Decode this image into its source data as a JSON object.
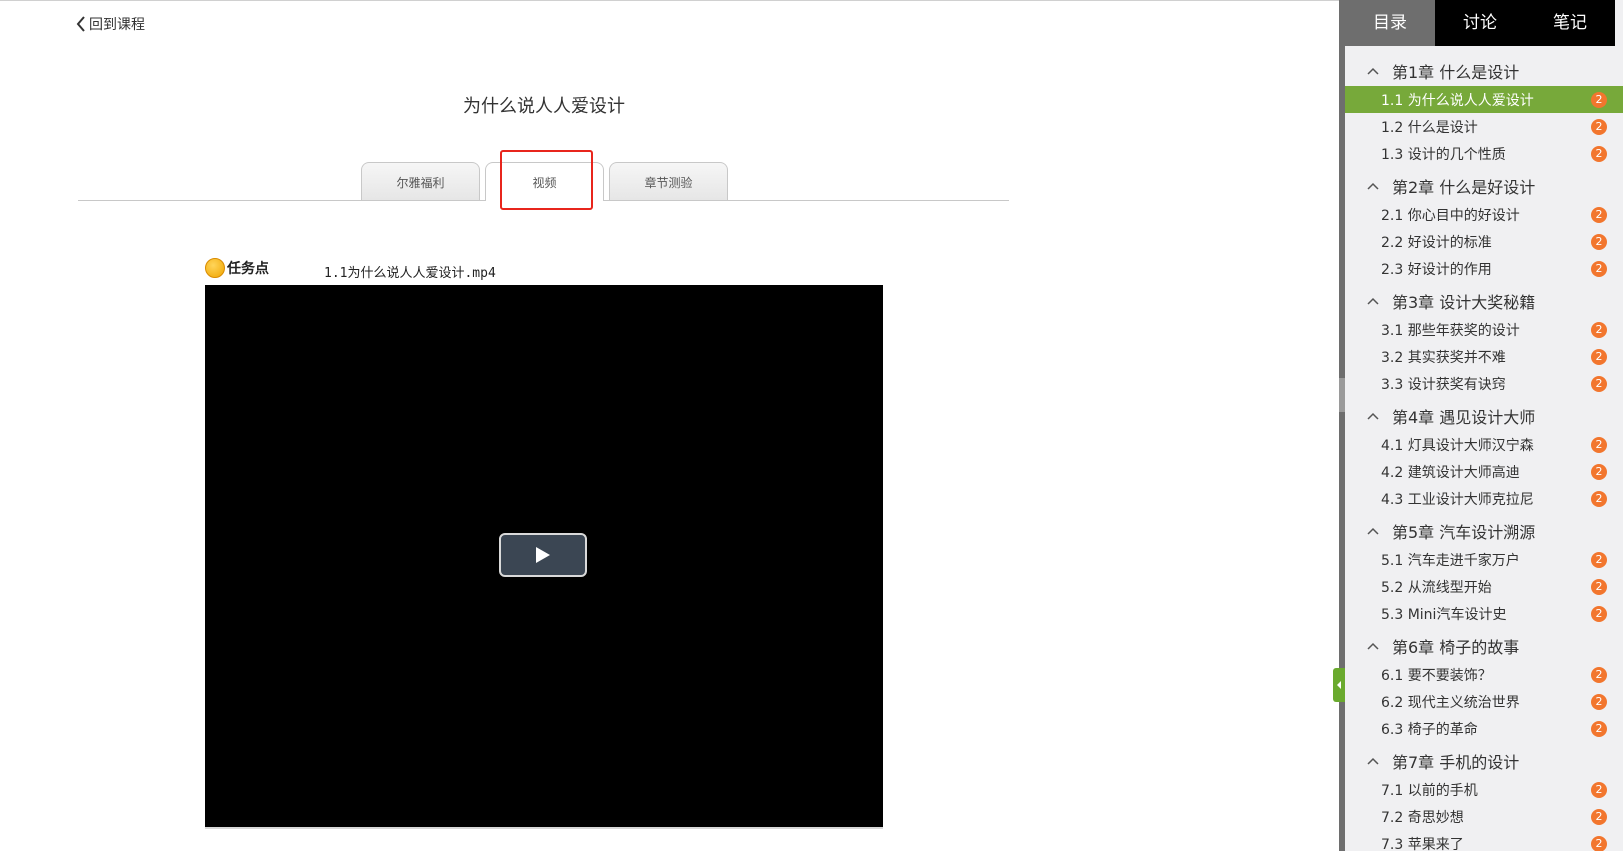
{
  "back_label": "回到课程",
  "page_title": "为什么说人人爱设计",
  "tabs": [
    {
      "label": "尔雅福利"
    },
    {
      "label": "视频"
    },
    {
      "label": "章节测验"
    }
  ],
  "task": {
    "label": "任务点",
    "file_name": "1.1为什么说人人爱设计.mp4"
  },
  "sidebar": {
    "tabs": [
      {
        "label": "目录"
      },
      {
        "label": "讨论"
      },
      {
        "label": "笔记"
      }
    ],
    "chapters": [
      {
        "title": "第1章 什么是设计",
        "sections": [
          {
            "label": "1.1 为什么说人人爱设计",
            "badge": "2"
          },
          {
            "label": "1.2 什么是设计",
            "badge": "2"
          },
          {
            "label": "1.3 设计的几个性质",
            "badge": "2"
          }
        ]
      },
      {
        "title": "第2章 什么是好设计",
        "sections": [
          {
            "label": "2.1 你心目中的好设计",
            "badge": "2"
          },
          {
            "label": "2.2 好设计的标准",
            "badge": "2"
          },
          {
            "label": "2.3 好设计的作用",
            "badge": "2"
          }
        ]
      },
      {
        "title": "第3章 设计大奖秘籍",
        "sections": [
          {
            "label": "3.1 那些年获奖的设计",
            "badge": "2"
          },
          {
            "label": "3.2 其实获奖并不难",
            "badge": "2"
          },
          {
            "label": "3.3 设计获奖有诀窍",
            "badge": "2"
          }
        ]
      },
      {
        "title": "第4章 遇见设计大师",
        "sections": [
          {
            "label": "4.1 灯具设计大师汉宁森",
            "badge": "2"
          },
          {
            "label": "4.2 建筑设计大师高迪",
            "badge": "2"
          },
          {
            "label": "4.3 工业设计大师克拉尼",
            "badge": "2"
          }
        ]
      },
      {
        "title": "第5章 汽车设计溯源",
        "sections": [
          {
            "label": "5.1 汽车走进千家万户",
            "badge": "2"
          },
          {
            "label": "5.2 从流线型开始",
            "badge": "2"
          },
          {
            "label": "5.3 Mini汽车设计史",
            "badge": "2"
          }
        ]
      },
      {
        "title": "第6章 椅子的故事",
        "sections": [
          {
            "label": "6.1 要不要装饰？",
            "badge": "2"
          },
          {
            "label": "6.2 现代主义统治世界",
            "badge": "2"
          },
          {
            "label": "6.3 椅子的革命",
            "badge": "2"
          }
        ]
      },
      {
        "title": "第7章 手机的设计",
        "sections": [
          {
            "label": "7.1 以前的手机",
            "badge": "2"
          },
          {
            "label": "7.2 奇思妙想",
            "badge": "2"
          },
          {
            "label": "7.3 苹果来了",
            "badge": "2"
          }
        ]
      }
    ]
  }
}
